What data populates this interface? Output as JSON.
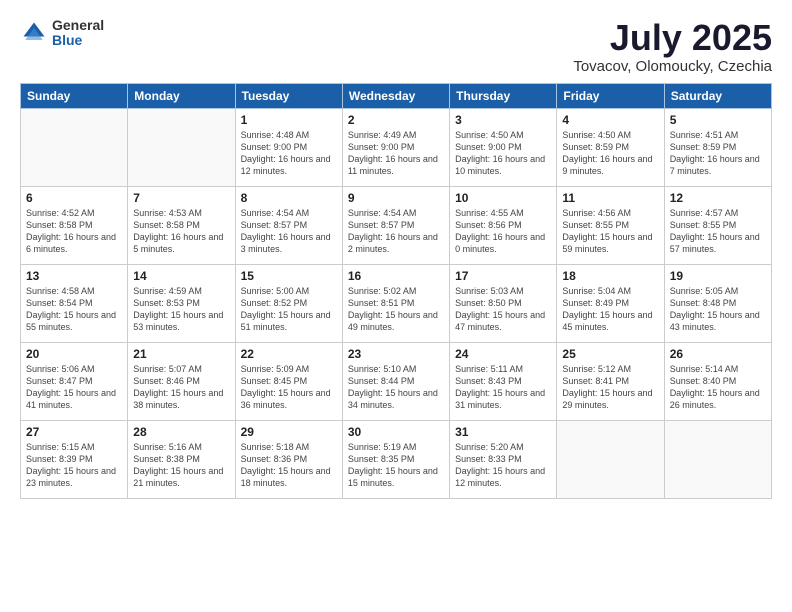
{
  "logo": {
    "general": "General",
    "blue": "Blue"
  },
  "title": {
    "month": "July 2025",
    "location": "Tovacov, Olomoucky, Czechia"
  },
  "weekdays": [
    "Sunday",
    "Monday",
    "Tuesday",
    "Wednesday",
    "Thursday",
    "Friday",
    "Saturday"
  ],
  "weeks": [
    [
      {
        "day": "",
        "info": ""
      },
      {
        "day": "",
        "info": ""
      },
      {
        "day": "1",
        "info": "Sunrise: 4:48 AM\nSunset: 9:00 PM\nDaylight: 16 hours and 12 minutes."
      },
      {
        "day": "2",
        "info": "Sunrise: 4:49 AM\nSunset: 9:00 PM\nDaylight: 16 hours and 11 minutes."
      },
      {
        "day": "3",
        "info": "Sunrise: 4:50 AM\nSunset: 9:00 PM\nDaylight: 16 hours and 10 minutes."
      },
      {
        "day": "4",
        "info": "Sunrise: 4:50 AM\nSunset: 8:59 PM\nDaylight: 16 hours and 9 minutes."
      },
      {
        "day": "5",
        "info": "Sunrise: 4:51 AM\nSunset: 8:59 PM\nDaylight: 16 hours and 7 minutes."
      }
    ],
    [
      {
        "day": "6",
        "info": "Sunrise: 4:52 AM\nSunset: 8:58 PM\nDaylight: 16 hours and 6 minutes."
      },
      {
        "day": "7",
        "info": "Sunrise: 4:53 AM\nSunset: 8:58 PM\nDaylight: 16 hours and 5 minutes."
      },
      {
        "day": "8",
        "info": "Sunrise: 4:54 AM\nSunset: 8:57 PM\nDaylight: 16 hours and 3 minutes."
      },
      {
        "day": "9",
        "info": "Sunrise: 4:54 AM\nSunset: 8:57 PM\nDaylight: 16 hours and 2 minutes."
      },
      {
        "day": "10",
        "info": "Sunrise: 4:55 AM\nSunset: 8:56 PM\nDaylight: 16 hours and 0 minutes."
      },
      {
        "day": "11",
        "info": "Sunrise: 4:56 AM\nSunset: 8:55 PM\nDaylight: 15 hours and 59 minutes."
      },
      {
        "day": "12",
        "info": "Sunrise: 4:57 AM\nSunset: 8:55 PM\nDaylight: 15 hours and 57 minutes."
      }
    ],
    [
      {
        "day": "13",
        "info": "Sunrise: 4:58 AM\nSunset: 8:54 PM\nDaylight: 15 hours and 55 minutes."
      },
      {
        "day": "14",
        "info": "Sunrise: 4:59 AM\nSunset: 8:53 PM\nDaylight: 15 hours and 53 minutes."
      },
      {
        "day": "15",
        "info": "Sunrise: 5:00 AM\nSunset: 8:52 PM\nDaylight: 15 hours and 51 minutes."
      },
      {
        "day": "16",
        "info": "Sunrise: 5:02 AM\nSunset: 8:51 PM\nDaylight: 15 hours and 49 minutes."
      },
      {
        "day": "17",
        "info": "Sunrise: 5:03 AM\nSunset: 8:50 PM\nDaylight: 15 hours and 47 minutes."
      },
      {
        "day": "18",
        "info": "Sunrise: 5:04 AM\nSunset: 8:49 PM\nDaylight: 15 hours and 45 minutes."
      },
      {
        "day": "19",
        "info": "Sunrise: 5:05 AM\nSunset: 8:48 PM\nDaylight: 15 hours and 43 minutes."
      }
    ],
    [
      {
        "day": "20",
        "info": "Sunrise: 5:06 AM\nSunset: 8:47 PM\nDaylight: 15 hours and 41 minutes."
      },
      {
        "day": "21",
        "info": "Sunrise: 5:07 AM\nSunset: 8:46 PM\nDaylight: 15 hours and 38 minutes."
      },
      {
        "day": "22",
        "info": "Sunrise: 5:09 AM\nSunset: 8:45 PM\nDaylight: 15 hours and 36 minutes."
      },
      {
        "day": "23",
        "info": "Sunrise: 5:10 AM\nSunset: 8:44 PM\nDaylight: 15 hours and 34 minutes."
      },
      {
        "day": "24",
        "info": "Sunrise: 5:11 AM\nSunset: 8:43 PM\nDaylight: 15 hours and 31 minutes."
      },
      {
        "day": "25",
        "info": "Sunrise: 5:12 AM\nSunset: 8:41 PM\nDaylight: 15 hours and 29 minutes."
      },
      {
        "day": "26",
        "info": "Sunrise: 5:14 AM\nSunset: 8:40 PM\nDaylight: 15 hours and 26 minutes."
      }
    ],
    [
      {
        "day": "27",
        "info": "Sunrise: 5:15 AM\nSunset: 8:39 PM\nDaylight: 15 hours and 23 minutes."
      },
      {
        "day": "28",
        "info": "Sunrise: 5:16 AM\nSunset: 8:38 PM\nDaylight: 15 hours and 21 minutes."
      },
      {
        "day": "29",
        "info": "Sunrise: 5:18 AM\nSunset: 8:36 PM\nDaylight: 15 hours and 18 minutes."
      },
      {
        "day": "30",
        "info": "Sunrise: 5:19 AM\nSunset: 8:35 PM\nDaylight: 15 hours and 15 minutes."
      },
      {
        "day": "31",
        "info": "Sunrise: 5:20 AM\nSunset: 8:33 PM\nDaylight: 15 hours and 12 minutes."
      },
      {
        "day": "",
        "info": ""
      },
      {
        "day": "",
        "info": ""
      }
    ]
  ]
}
